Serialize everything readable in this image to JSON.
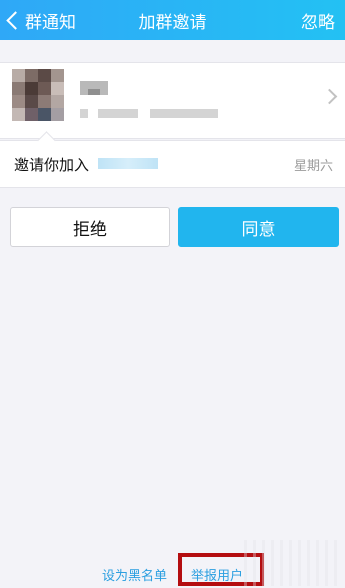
{
  "header": {
    "back_label": "群通知",
    "title": "加群邀请",
    "ignore_label": "忽略"
  },
  "invite": {
    "text": "邀请你加入",
    "time": "星期六"
  },
  "actions": {
    "reject_label": "拒绝",
    "accept_label": "同意"
  },
  "footer": {
    "blacklist_label": "设为黑名单",
    "report_label": "举报用户"
  },
  "colors": {
    "header_gradient_start": "#2fa8f7",
    "header_gradient_end": "#23c1f3",
    "accept_button": "#21b5ee",
    "link": "#2b9fe0",
    "highlight": "#b40d10"
  }
}
